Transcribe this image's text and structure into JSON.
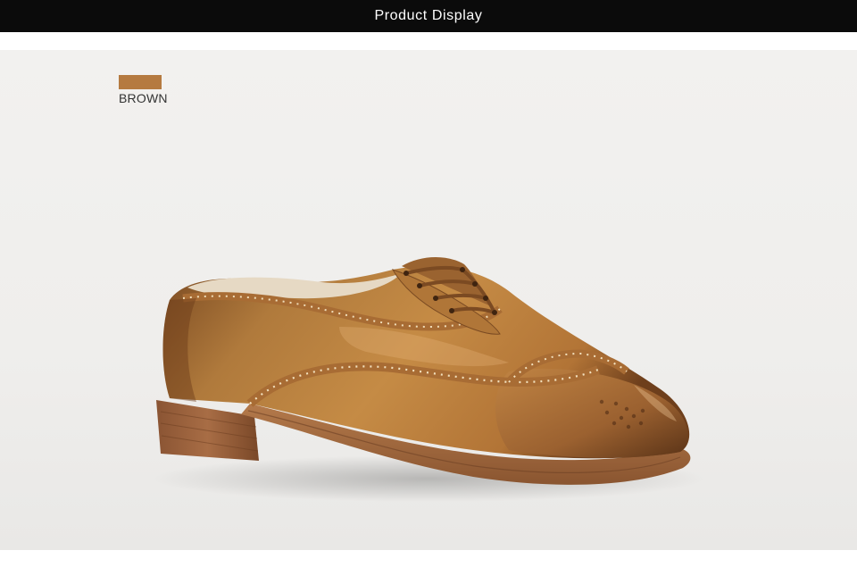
{
  "header": {
    "title": "Product Display"
  },
  "color_option": {
    "label": "BROWN",
    "swatch_color": "#b57a40"
  },
  "product_image": {
    "subject": "brown leather wingtip brogue oxford shoe",
    "icon": "shoe-icon"
  },
  "colors": {
    "header_bg": "#0b0b0b",
    "header_text": "#ffffff",
    "stage_bg": "#f0efed"
  }
}
